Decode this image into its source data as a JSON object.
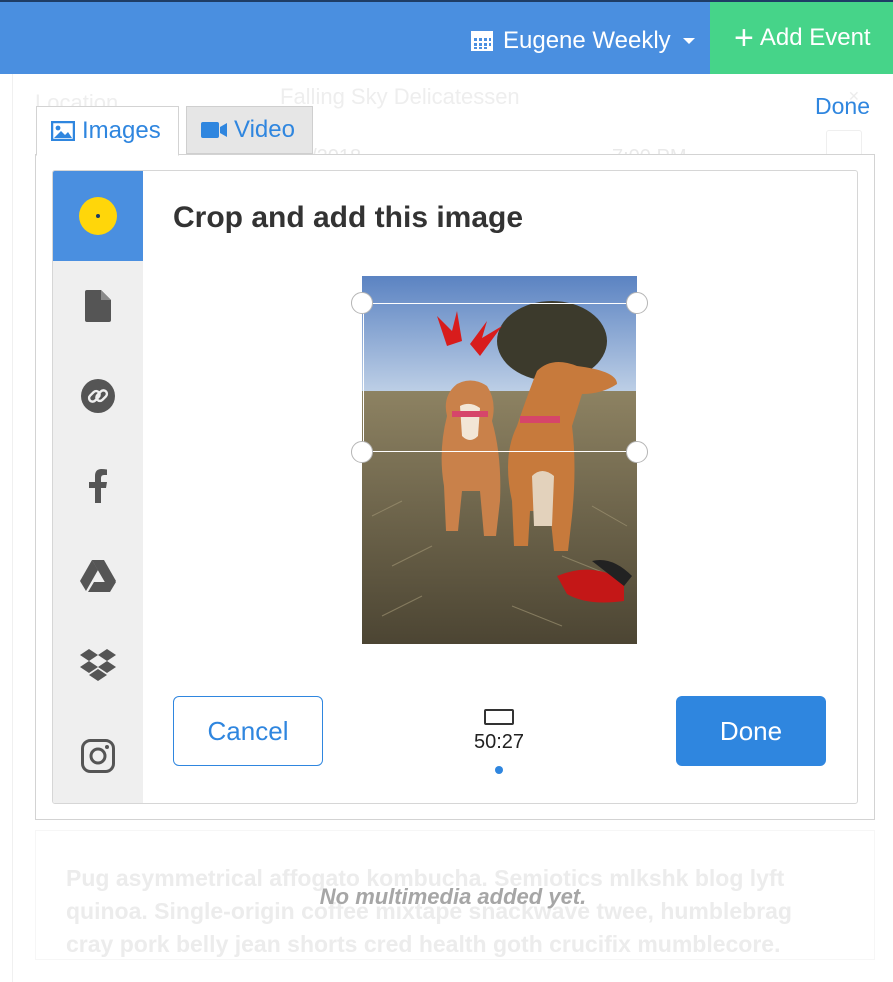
{
  "header": {
    "calendar_name": "Eugene Weekly",
    "add_event_label": "Add Event"
  },
  "background": {
    "location_label": "Location",
    "venue": "Falling Sky Delicatessen",
    "date_fragment": "1/2018",
    "time_fragment": "7:00 PM",
    "done_link": "Done"
  },
  "media": {
    "tabs": [
      {
        "label": "Images",
        "icon": "image-icon"
      },
      {
        "label": "Video",
        "icon": "video-camera-icon"
      }
    ],
    "sources": [
      {
        "icon": "camera-lens-icon",
        "active": true
      },
      {
        "icon": "file-icon"
      },
      {
        "icon": "link-icon"
      },
      {
        "icon": "facebook-icon"
      },
      {
        "icon": "google-drive-icon"
      },
      {
        "icon": "dropbox-icon"
      },
      {
        "icon": "instagram-icon"
      }
    ],
    "dialog_title": "Crop and add this image",
    "cancel_label": "Cancel",
    "done_label": "Done",
    "aspect_ratio": "50:27",
    "empty_message": "No multimedia added yet."
  },
  "description_text": "Pug asymmetrical affogato kombucha. Semiotics mlkshk blog lyft quinoa. Single-origin coffee mixtape snackwave twee, humblebrag cray pork belly jean shorts cred health goth crucifix mumblecore.",
  "colors": {
    "topbar": "#4a8fe0",
    "add_event": "#46d489",
    "accent": "#2f86df"
  }
}
